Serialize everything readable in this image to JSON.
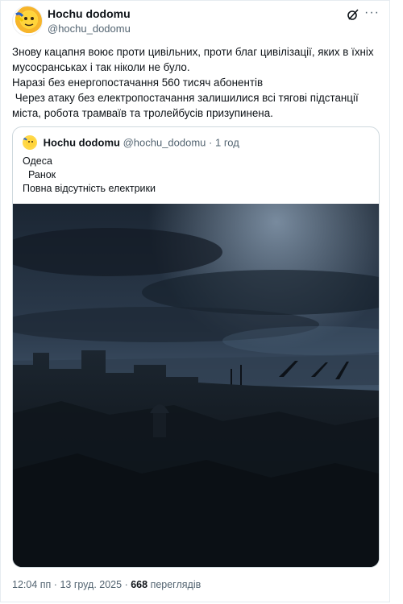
{
  "post": {
    "display_name": "Hochu dodomu",
    "handle": "@hochu_dodomu",
    "text_lines": [
      "Знову кацапня воює проти цивільних, проти благ цивілізації, яких в їхніх",
      "мусосранськах і так ніколи не було.",
      "Наразі без енергопостачання 560 тисяч абонентів",
      " Через атаку без електропостачання залишилися всі тягові підстанції",
      "міста, робота трамваїв та тролейбусів призупинена."
    ]
  },
  "quote": {
    "display_name": "Hochu dodomu",
    "handle": "@hochu_dodomu",
    "separator": "·",
    "time_ago": "1 год",
    "text_lines": [
      "Одеса",
      "  Ранок",
      "Повна відсутність електрики"
    ]
  },
  "footer": {
    "time": "12:04 пп",
    "separator": "·",
    "date": "13 груд. 2025",
    "views_count": "668",
    "views_label": "переглядів"
  },
  "icons": {
    "grok": "grok-icon",
    "more": "more-options-icon"
  },
  "colors": {
    "text": "#0f1419",
    "muted": "#536471",
    "border": "#cfd9de"
  }
}
